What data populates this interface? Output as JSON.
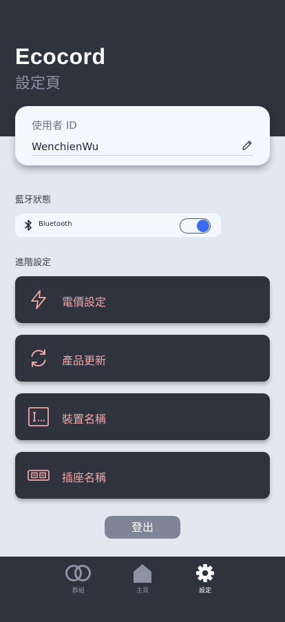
{
  "header": {
    "app_title": "Ecocord",
    "page_subtitle": "設定頁"
  },
  "user": {
    "label": "使用者 ID",
    "value": "WenchienWu",
    "edit_icon": "pencil-icon"
  },
  "bluetooth": {
    "section_label": "藍牙狀態",
    "label": "Bluetooth",
    "icon": "bluetooth-icon",
    "enabled": true,
    "toggle_color": "#3b6df0"
  },
  "advanced": {
    "section_label": "進階設定",
    "items": [
      {
        "label": "電價設定",
        "icon": "lightning-icon"
      },
      {
        "label": "產品更新",
        "icon": "refresh-icon"
      },
      {
        "label": "裝置名稱",
        "icon": "text-cursor-icon"
      },
      {
        "label": "插座名稱",
        "icon": "socket-icon"
      }
    ]
  },
  "logout_label": "登出",
  "colors": {
    "header_bg": "#2e333e",
    "page_bg": "#e3e8f0",
    "menu_text": "#f2a6a4",
    "accent": "#3b6df0"
  },
  "nav": {
    "items": [
      {
        "label": "群組",
        "icon": "group-icon",
        "active": false
      },
      {
        "label": "主頁",
        "icon": "home-icon",
        "active": false
      },
      {
        "label": "設定",
        "icon": "gear-icon",
        "active": true
      }
    ]
  }
}
